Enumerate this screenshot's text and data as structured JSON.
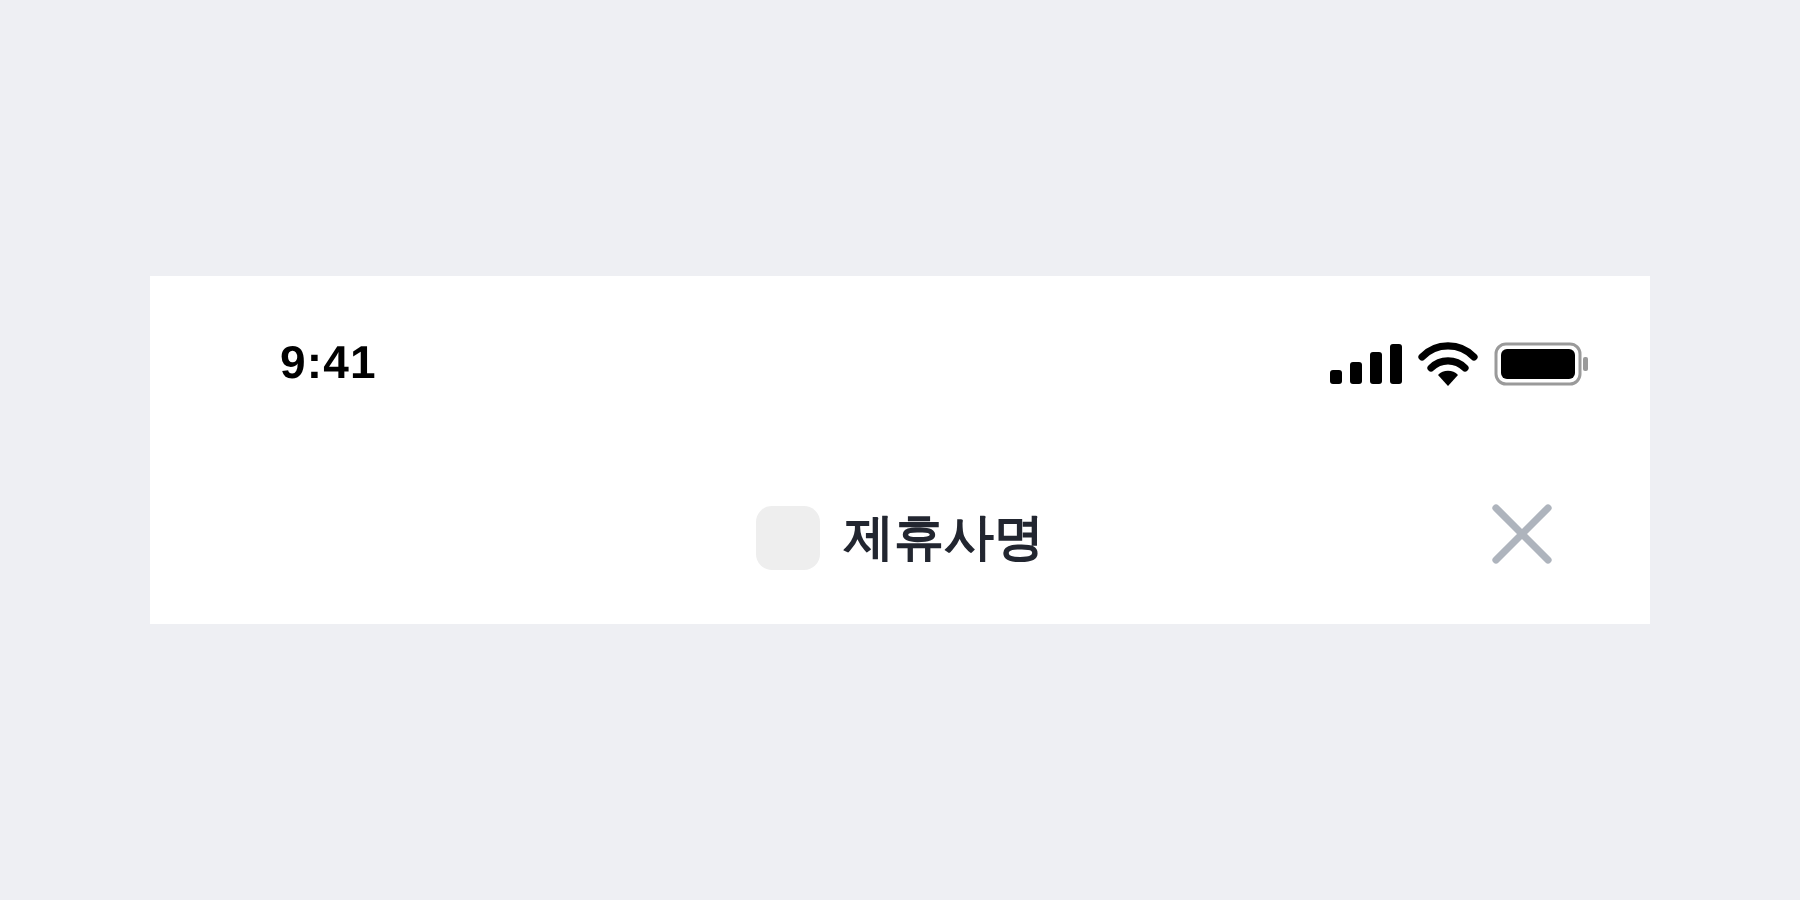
{
  "status_bar": {
    "time": "9:41"
  },
  "header": {
    "title": "제휴사명"
  }
}
